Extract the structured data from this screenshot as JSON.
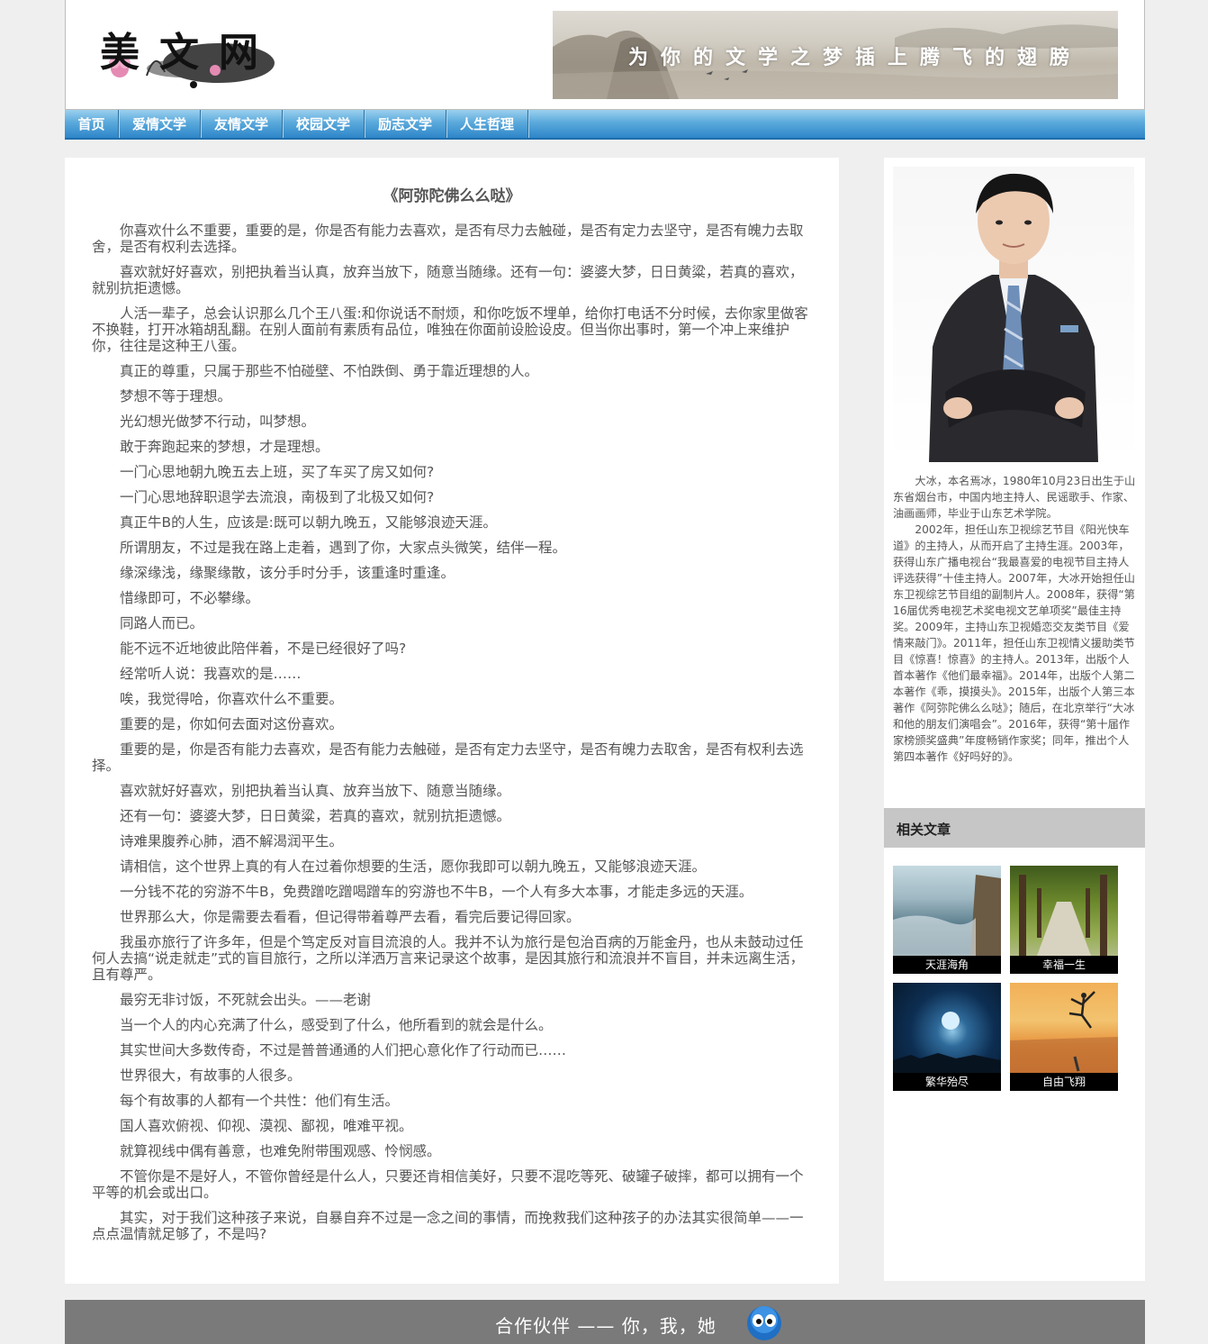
{
  "header": {
    "logo_text": "美文网",
    "banner_slogan": "为你的文学之梦插上腾飞的翅膀"
  },
  "nav": {
    "items": [
      "首页",
      "爱情文学",
      "友情文学",
      "校园文学",
      "励志文学",
      "人生哲理"
    ]
  },
  "article": {
    "title": "《阿弥陀佛么么哒》",
    "paragraphs": [
      "你喜欢什么不重要，重要的是，你是否有能力去喜欢，是否有尽力去触碰，是否有定力去坚守，是否有魄力去取舍，是否有权利去选择。",
      "喜欢就好好喜欢，别把执着当认真，放弃当放下，随意当随缘。还有一句：婆婆大梦，日日黄粱，若真的喜欢，就别抗拒遗憾。",
      "人活一辈子，总会认识那么几个王八蛋:和你说话不耐烦，和你吃饭不埋单，给你打电话不分时候，去你家里做客不换鞋，打开冰箱胡乱翻。在别人面前有素质有品位，唯独在你面前设脸设皮。但当你出事时，第一个冲上来维护你，往往是这种王八蛋。",
      "真正的尊重，只属于那些不怕碰壁、不怕跌倒、勇于靠近理想的人。",
      "梦想不等于理想。",
      "光幻想光做梦不行动，叫梦想。",
      "敢于奔跑起来的梦想，才是理想。",
      "一门心思地朝九晚五去上班，买了车买了房又如何?",
      "一门心思地辞职退学去流浪，南极到了北极又如何?",
      "真正牛B的人生，应该是:既可以朝九晚五，又能够浪迹天涯。",
      "所谓朋友，不过是我在路上走着，遇到了你，大家点头微笑，结伴一程。",
      "缘深缘浅，缘聚缘散，该分手时分手，该重逢时重逢。",
      "惜缘即可，不必攀缘。",
      "同路人而已。",
      "能不远不近地彼此陪伴着，不是已经很好了吗?",
      "经常听人说：我喜欢的是……",
      "唉，我觉得哈，你喜欢什么不重要。",
      "重要的是，你如何去面对这份喜欢。",
      "重要的是，你是否有能力去喜欢，是否有能力去触碰，是否有定力去坚守，是否有魄力去取舍，是否有权利去选择。",
      "喜欢就好好喜欢，别把执着当认真、放弃当放下、随意当随缘。",
      "还有一句：婆婆大梦，日日黄粱，若真的喜欢，就别抗拒遗憾。",
      "诗难果腹养心肺，酒不解渴润平生。",
      "请相信，这个世界上真的有人在过着你想要的生活，愿你我即可以朝九晚五，又能够浪迹天涯。",
      "一分钱不花的穷游不牛B，免费蹭吃蹭喝蹭车的穷游也不牛B，一个人有多大本事，才能走多远的天涯。",
      "世界那么大，你是需要去看看，但记得带着尊严去看，看完后要记得回家。",
      "我虽亦旅行了许多年，但是个笃定反对盲目流浪的人。我并不认为旅行是包治百病的万能金丹，也从未鼓动过任何人去搞“说走就走”式的盲目旅行，之所以洋洒万言来记录这个故事，是因其旅行和流浪并不盲目，并未远离生活，且有尊严。",
      "最穷无非讨饭，不死就会出头。——老谢",
      "当一个人的内心充满了什么，感受到了什么，他所看到的就会是什么。",
      "其实世间大多数传奇，不过是普普通通的人们把心意化作了行动而已……",
      "世界很大，有故事的人很多。",
      "每个有故事的人都有一个共性：他们有生活。",
      "国人喜欢俯视、仰视、漠视、鄙视，唯难平视。",
      "就算视线中偶有善意，也难免附带围观感、怜悯感。",
      "不管你是不是好人，不管你曾经是什么人，只要还肯相信美好，只要不混吃等死、破罐子破摔，都可以拥有一个平等的机会或出口。",
      "其实，对于我们这种孩子来说，自暴自弃不过是一念之间的事情，而挽救我们这种孩子的办法其实很简单——一点点温情就足够了，不是吗?"
    ]
  },
  "sidebar": {
    "bio": [
      "大冰，本名焉冰，1980年10月23日出生于山东省烟台市，中国内地主持人、民谣歌手、作家、油画画师，毕业于山东艺术学院。",
      "2002年，担任山东卫视综艺节目《阳光快车道》的主持人，从而开启了主持生涯。2003年，获得山东广播电视台“我最喜爱的电视节目主持人评选获得”十佳主持人。2007年，大冰开始担任山东卫视综艺节目组的副制片人。2008年，获得“第16届优秀电视艺术奖电视文艺单项奖”最佳主持奖。2009年，主持山东卫视婚恋交友类节目《爱情来敲门》。2011年，担任山东卫视情义援助类节目《惊喜！惊喜》的主持人。2013年，出版个人首本著作《他们最幸福》。2014年，出版个人第二本著作《乖，摸摸头》。2015年，出版个人第三本著作《阿弥陀佛么么哒》；随后，在北京举行“大冰和他的朋友们演唱会”。2016年，获得“第十届作家榜颁奖盛典”年度畅销作家奖；同年，推出个人第四本著作《好吗好的》。"
    ],
    "related_title": "相关文章",
    "related": [
      "天涯海角",
      "幸福一生",
      "繁华殆尽",
      "自由飞翔"
    ]
  },
  "footer": {
    "text": "合作伙伴 —— 你，我，她"
  }
}
